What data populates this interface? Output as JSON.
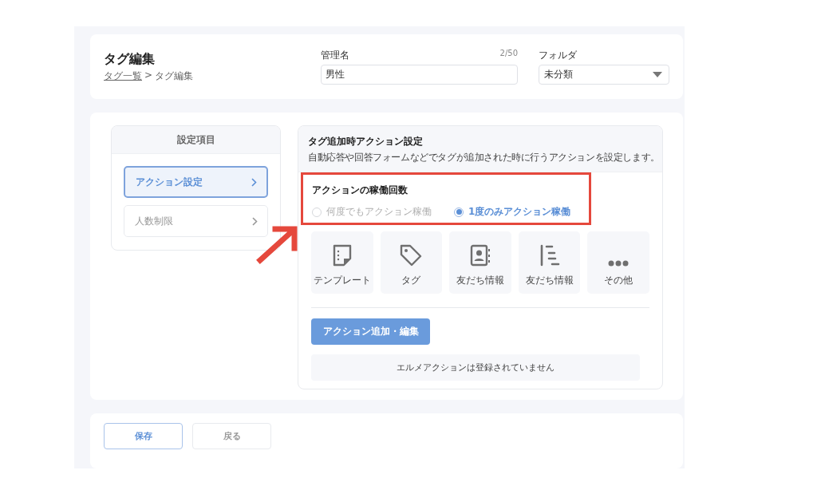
{
  "header": {
    "title": "タグ編集",
    "breadcrumb": [
      {
        "label": "タグ一覧",
        "link": true
      },
      {
        "label": ">",
        "link": false
      },
      {
        "label": "タグ編集",
        "link": false
      }
    ],
    "name_field": {
      "label": "管理名",
      "counter": "2/50",
      "value": "男性"
    },
    "folder_field": {
      "label": "フォルダ",
      "value": "未分類"
    }
  },
  "sidebar": {
    "title": "設定項目",
    "items": [
      {
        "label": "アクション設定",
        "selected": true
      },
      {
        "label": "人数制限",
        "selected": false
      }
    ]
  },
  "panel": {
    "title": "タグ追加時アクション設定",
    "description": "自動応答や回答フォームなどでタグが追加された時に行うアクションを設定します。",
    "run_count": {
      "label": "アクションの稼働回数",
      "options": [
        {
          "label": "何度でもアクション稼働",
          "selected": false
        },
        {
          "label": "1度のみアクション稼働",
          "selected": true
        }
      ]
    },
    "actions": [
      {
        "kind": "template",
        "label": "テンプレート"
      },
      {
        "kind": "tag",
        "label": "タグ"
      },
      {
        "kind": "contact",
        "label": "友だち情報"
      },
      {
        "kind": "list",
        "label": "友だち情報"
      },
      {
        "kind": "more",
        "label": "その他"
      }
    ],
    "add_button": "アクション追加・編集",
    "empty_message": "エルメアクションは登録されていません"
  },
  "footer": {
    "buttons": [
      {
        "label": "保存",
        "kind": "primary"
      },
      {
        "label": "戻る",
        "kind": "secondary"
      }
    ]
  }
}
